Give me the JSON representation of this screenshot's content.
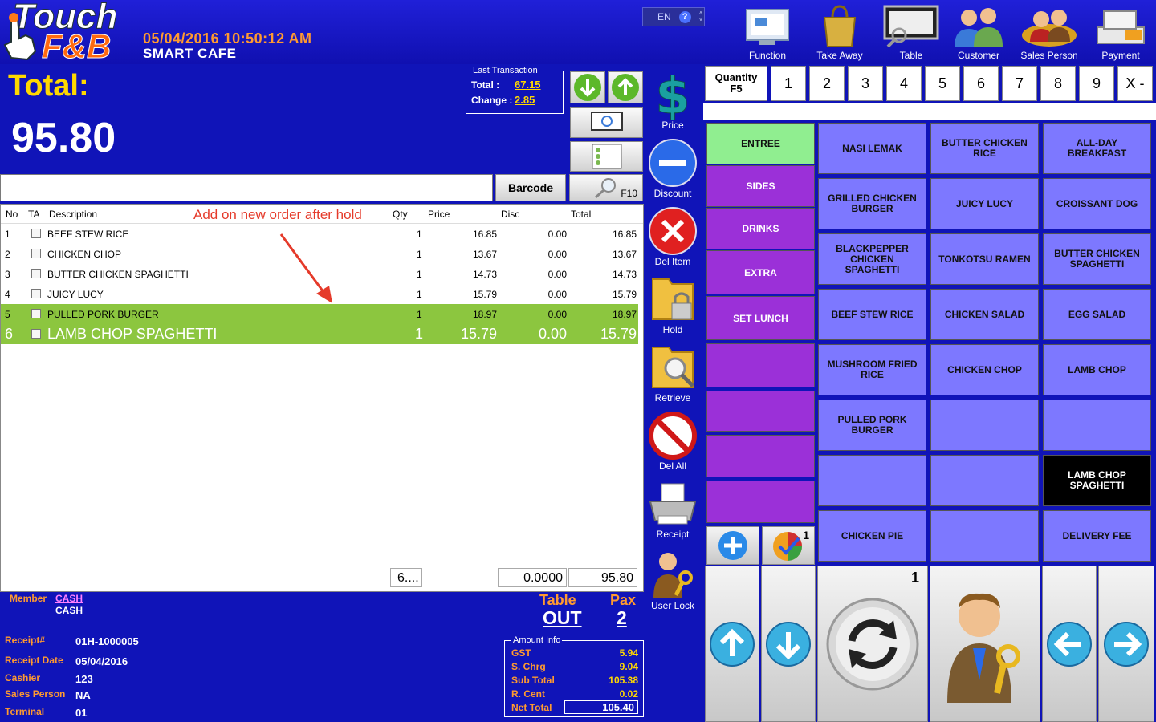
{
  "header": {
    "logo_top": "Touch",
    "logo_bottom": "F&B",
    "datetime": "05/04/2016 10:50:12 AM",
    "store": "SMART CAFE",
    "lang": "EN",
    "lang_help": "?",
    "buttons": [
      {
        "label": "Function",
        "icon": "function-icon"
      },
      {
        "label": "Take Away",
        "icon": "shopping-bag-icon"
      },
      {
        "label": "Table",
        "icon": "monitor-search-icon"
      },
      {
        "label": "Customer",
        "icon": "customers-icon"
      },
      {
        "label": "Sales Person",
        "icon": "sales-person-icon"
      },
      {
        "label": "Payment",
        "icon": "cash-register-icon"
      }
    ]
  },
  "summary": {
    "total_label": "Total:",
    "total_value": "95.80",
    "last_tx_caption": "Last Transaction",
    "last_total_label": "Total :",
    "last_total_value": "67.15",
    "last_change_label": "Change :",
    "last_change_value": "2.85"
  },
  "search": {
    "barcode_label": "Barcode",
    "f10_label": "F10"
  },
  "grid": {
    "columns": [
      "No",
      "TA",
      "Description",
      "Qty",
      "Price",
      "Disc",
      "Total"
    ],
    "rows": [
      {
        "no": "1",
        "desc": "BEEF STEW RICE",
        "qty": "1",
        "price": "16.85",
        "disc": "0.00",
        "total": "16.85"
      },
      {
        "no": "2",
        "desc": "CHICKEN CHOP",
        "qty": "1",
        "price": "13.67",
        "disc": "0.00",
        "total": "13.67"
      },
      {
        "no": "3",
        "desc": "BUTTER CHICKEN SPAGHETTI",
        "qty": "1",
        "price": "14.73",
        "disc": "0.00",
        "total": "14.73"
      },
      {
        "no": "4",
        "desc": "JUICY LUCY",
        "qty": "1",
        "price": "15.79",
        "disc": "0.00",
        "total": "15.79"
      },
      {
        "no": "5",
        "desc": "PULLED PORK BURGER",
        "qty": "1",
        "price": "18.97",
        "disc": "0.00",
        "total": "18.97"
      },
      {
        "no": "6",
        "desc": "LAMB CHOP SPAGHETTI",
        "qty": "1",
        "price": "15.79",
        "disc": "0.00",
        "total": "15.79"
      }
    ],
    "annotation": "Add on new order after hold",
    "footer_qty": "6....",
    "footer_disc": "0.0000",
    "footer_total": "95.80"
  },
  "member": {
    "label": "Member",
    "value": "CASH",
    "sub": "CASH"
  },
  "table": {
    "label": "Table",
    "value": "OUT",
    "pax_label": "Pax",
    "pax_value": "2"
  },
  "receipt": [
    {
      "label": "Receipt#",
      "value": "01H-1000005"
    },
    {
      "label": "Receipt Date",
      "value": "05/04/2016"
    },
    {
      "label": "Cashier",
      "value": "123"
    },
    {
      "label": "Sales Person",
      "value": "NA"
    },
    {
      "label": "Terminal",
      "value": "01"
    }
  ],
  "amount": {
    "caption": "Amount Info",
    "rows": [
      {
        "label": "GST",
        "value": "5.94"
      },
      {
        "label": "S. Chrg",
        "value": "9.04"
      },
      {
        "label": "Sub Total",
        "value": "105.38"
      },
      {
        "label": "R. Cent",
        "value": "0.02"
      }
    ],
    "net_label": "Net Total",
    "net_value": "105.40"
  },
  "side": [
    {
      "label": "Price",
      "icon": "dollar-icon"
    },
    {
      "label": "Discount",
      "icon": "minus-circle-icon"
    },
    {
      "label": "Del Item",
      "icon": "delete-x-icon"
    },
    {
      "label": "Hold",
      "icon": "folder-lock-icon"
    },
    {
      "label": "Retrieve",
      "icon": "folder-search-icon"
    },
    {
      "label": "Del All",
      "icon": "no-entry-icon"
    },
    {
      "label": "Receipt",
      "icon": "printer-icon"
    },
    {
      "label": "User Lock",
      "icon": "user-key-icon"
    }
  ],
  "quantity": {
    "label": "Quantity",
    "shortcut": "F5",
    "keys": [
      "1",
      "2",
      "3",
      "4",
      "5",
      "6",
      "7",
      "8",
      "9",
      "X -"
    ]
  },
  "categories": [
    "ENTREE",
    "SIDES",
    "DRINKS",
    "EXTRA",
    "SET LUNCH",
    "",
    "",
    "",
    ""
  ],
  "items": [
    "NASI LEMAK",
    "BUTTER CHICKEN RICE",
    "ALL-DAY BREAKFAST",
    "GRILLED CHICKEN BURGER",
    "JUICY LUCY",
    "CROISSANT DOG",
    "BLACKPEPPER CHICKEN SPAGHETTI",
    "TONKOTSU RAMEN",
    "BUTTER CHICKEN SPAGHETTI",
    "BEEF STEW RICE",
    "CHICKEN SALAD",
    "EGG SALAD",
    "MUSHROOM FRIED RICE",
    "CHICKEN CHOP",
    "LAMB CHOP",
    "PULLED PORK BURGER",
    "",
    "",
    "",
    "",
    "LAMB CHOP SPAGHETTI",
    "CHICKEN PIE",
    "",
    "DELIVERY FEE"
  ],
  "page_counter": "1",
  "badge_count": "1",
  "colors": {
    "background": "#1014b8",
    "accent_orange": "#ff9a30",
    "total_yellow": "#ffd800",
    "selected_row": "#8cc63f",
    "category_active": "#90ee90",
    "category": "#9b30d8",
    "item": "#7d78ff",
    "item_selected": "#000000"
  }
}
